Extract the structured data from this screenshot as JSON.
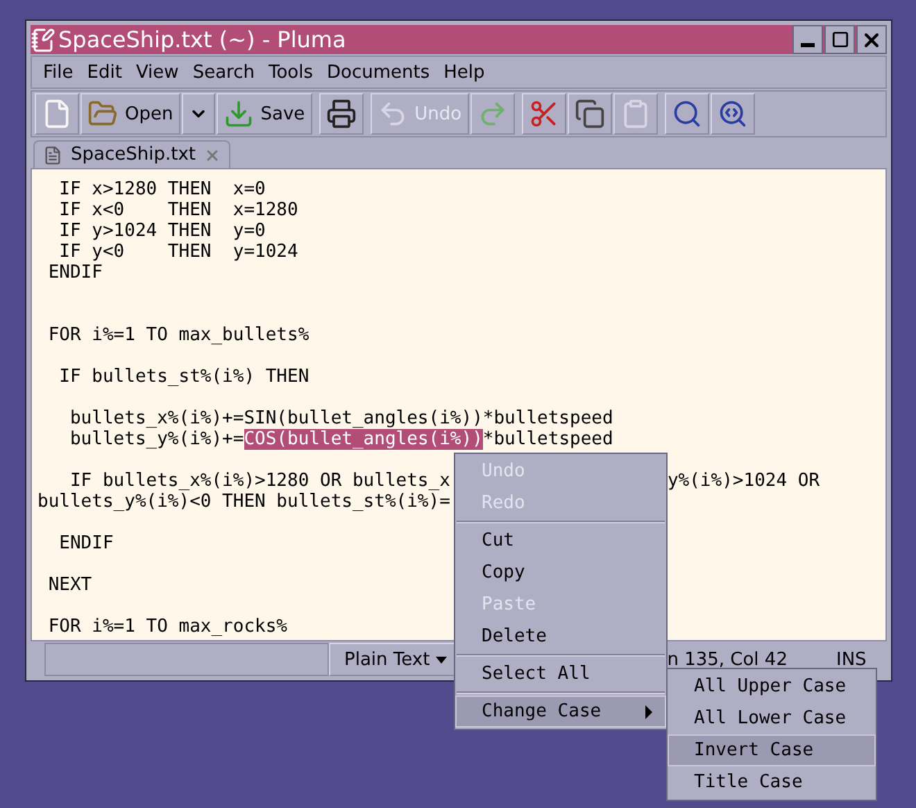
{
  "window": {
    "title": "SpaceShip.txt (~) - Pluma"
  },
  "menu_bar": [
    "File",
    "Edit",
    "View",
    "Search",
    "Tools",
    "Documents",
    "Help"
  ],
  "toolbar": [
    {
      "kind": "new",
      "disabled": false
    },
    {
      "kind": "open",
      "label": "Open",
      "disabled": false
    },
    {
      "kind": "dropdown",
      "disabled": false
    },
    {
      "kind": "save",
      "label": "Save",
      "disabled": false
    },
    {
      "kind": "print",
      "disabled": false
    },
    {
      "kind": "undo",
      "label": "Undo",
      "disabled": true
    },
    {
      "kind": "redo",
      "disabled": false
    },
    {
      "kind": "cut",
      "disabled": false
    },
    {
      "kind": "copy",
      "disabled": false
    },
    {
      "kind": "paste",
      "disabled": true
    },
    {
      "kind": "find",
      "disabled": false
    },
    {
      "kind": "replace",
      "disabled": false
    }
  ],
  "tabs": [
    {
      "label": "SpaceShip.txt"
    }
  ],
  "editor": {
    "lines": [
      {
        "kind": "code",
        "parts": [
          {
            "kind": "plain",
            "text": "  IF x>1280 THEN  x=0"
          }
        ]
      },
      {
        "kind": "code",
        "parts": [
          {
            "kind": "plain",
            "text": "  IF x<0    THEN  x=1280"
          }
        ]
      },
      {
        "kind": "code",
        "parts": [
          {
            "kind": "plain",
            "text": "  IF y>1024 THEN  y=0"
          }
        ]
      },
      {
        "kind": "code",
        "parts": [
          {
            "kind": "plain",
            "text": "  IF y<0    THEN  y=1024"
          }
        ]
      },
      {
        "kind": "code",
        "parts": [
          {
            "kind": "plain",
            "text": " ENDIF"
          }
        ]
      },
      {
        "kind": "blank"
      },
      {
        "kind": "blank"
      },
      {
        "kind": "code",
        "parts": [
          {
            "kind": "plain",
            "text": " FOR i%=1 TO max_bullets%"
          }
        ]
      },
      {
        "kind": "blank"
      },
      {
        "kind": "code",
        "parts": [
          {
            "kind": "plain",
            "text": "  IF bullets_st%(i%) THEN"
          }
        ]
      },
      {
        "kind": "blank"
      },
      {
        "kind": "code",
        "parts": [
          {
            "kind": "plain",
            "text": "   bullets_x%(i%)+=SIN(bullet_angles(i%))*bulletspeed"
          }
        ]
      },
      {
        "kind": "code",
        "parts": [
          {
            "kind": "plain",
            "text": "   bullets_y%(i%)+="
          },
          {
            "kind": "selected",
            "text": "COS(bullet_angles(i%))"
          },
          {
            "kind": "plain",
            "text": "*bulletspeed"
          }
        ]
      },
      {
        "kind": "blank"
      },
      {
        "kind": "code",
        "parts": [
          {
            "kind": "plain",
            "text": "   IF bullets_x%(i%)>1280 OR bullets_x"
          },
          {
            "kind": "after-menu",
            "text": "y%(i%)>1024 OR"
          }
        ]
      },
      {
        "kind": "code",
        "parts": [
          {
            "kind": "plain",
            "text": "bullets_y%(i%)<0 THEN bullets_st%(i%)="
          }
        ]
      },
      {
        "kind": "blank"
      },
      {
        "kind": "code",
        "parts": [
          {
            "kind": "plain",
            "text": "  ENDIF"
          }
        ]
      },
      {
        "kind": "blank"
      },
      {
        "kind": "code",
        "parts": [
          {
            "kind": "plain",
            "text": " NEXT"
          }
        ]
      },
      {
        "kind": "blank"
      },
      {
        "kind": "code",
        "parts": [
          {
            "kind": "plain",
            "text": " FOR i%=1 TO max_rocks%"
          }
        ]
      }
    ]
  },
  "status_bar": {
    "language": "Plain Text",
    "position": "n 135, Col 42",
    "mode": "INS"
  },
  "context_menu": {
    "items": [
      {
        "kind": "item",
        "label": "Undo",
        "disabled": true,
        "selected": false
      },
      {
        "kind": "item",
        "label": "Redo",
        "disabled": true,
        "selected": false
      },
      {
        "kind": "separator"
      },
      {
        "kind": "item",
        "label": "Cut",
        "disabled": false,
        "selected": false
      },
      {
        "kind": "item",
        "label": "Copy",
        "disabled": false,
        "selected": false
      },
      {
        "kind": "item",
        "label": "Paste",
        "disabled": true,
        "selected": false
      },
      {
        "kind": "item",
        "label": "Delete",
        "disabled": false,
        "selected": false
      },
      {
        "kind": "separator"
      },
      {
        "kind": "item",
        "label": "Select All",
        "disabled": false,
        "selected": false
      },
      {
        "kind": "separator"
      },
      {
        "kind": "submenu",
        "label": "Change Case",
        "disabled": false,
        "selected": true
      }
    ]
  },
  "submenu": {
    "items": [
      {
        "label": "All Upper Case",
        "selected": false
      },
      {
        "label": "All Lower Case",
        "selected": false
      },
      {
        "label": "Invert Case",
        "selected": true
      },
      {
        "label": "Title Case",
        "selected": false
      }
    ]
  }
}
